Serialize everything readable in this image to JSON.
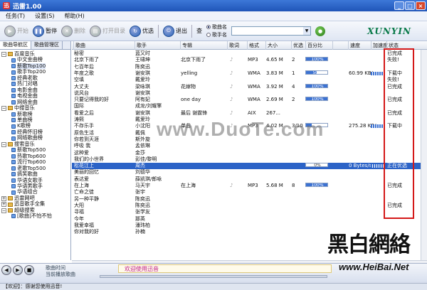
{
  "app": {
    "title": "迅雷1.00",
    "icon": "迅"
  },
  "menu": [
    "任务(T)",
    "设置(S)",
    "帮助(H)"
  ],
  "toolbar": {
    "buttons": [
      {
        "label": "开始",
        "enabled": false
      },
      {
        "label": "暂停",
        "enabled": true
      },
      {
        "label": "删除",
        "enabled": false
      },
      {
        "label": "打开目录",
        "enabled": false
      },
      {
        "label": "优选",
        "enabled": true
      },
      {
        "label": "退出",
        "enabled": true
      }
    ],
    "search_label": "查",
    "search_options": [
      {
        "label": "歌曲名",
        "selected": true
      },
      {
        "label": "歌手名",
        "selected": false
      }
    ],
    "search_value": "",
    "logo": "XUNYIN"
  },
  "sidebar": {
    "tabs": [
      "歌曲导航区",
      "歌曲管理区"
    ],
    "tree": [
      {
        "label": "百度音乐",
        "level": 0,
        "type": "folder",
        "expanded": true
      },
      {
        "label": "中文金曲榜",
        "level": 1
      },
      {
        "label": "新歌Top100",
        "level": 1
      },
      {
        "label": "歌手Top200",
        "level": 1
      },
      {
        "label": "经典老歌",
        "level": 1
      },
      {
        "label": "热门对唱",
        "level": 1
      },
      {
        "label": "电影金曲",
        "level": 1
      },
      {
        "label": "电视金曲",
        "level": 1
      },
      {
        "label": "网络金曲",
        "level": 1
      },
      {
        "label": "中搜音乐",
        "level": 0,
        "type": "folder",
        "expanded": true
      },
      {
        "label": "新歌榜",
        "level": 1
      },
      {
        "label": "单曲榜",
        "level": 1
      },
      {
        "label": "K歌榜",
        "level": 1
      },
      {
        "label": "经典怀旧榜",
        "level": 1
      },
      {
        "label": "网络歌曲榜",
        "level": 1
      },
      {
        "label": "搜索音乐",
        "level": 0,
        "type": "folder",
        "expanded": true
      },
      {
        "label": "新歌Top500",
        "level": 1
      },
      {
        "label": "热歌Top600",
        "level": 1
      },
      {
        "label": "流行Top600",
        "level": 1
      },
      {
        "label": "老歌Top500",
        "level": 1
      },
      {
        "label": "搞笑歌曲",
        "level": 1
      },
      {
        "label": "华语女歌手",
        "level": 1
      },
      {
        "label": "华语男歌手",
        "level": 1
      },
      {
        "label": "华语组合",
        "level": 1
      },
      {
        "label": "迅雷网吧",
        "level": 0,
        "type": "folder",
        "expanded": false
      },
      {
        "label": "迅音歌手全集",
        "level": 0,
        "type": "folder",
        "expanded": false
      },
      {
        "label": "超级搜索",
        "level": 0,
        "type": "folder",
        "expanded": true
      },
      {
        "label": "[歌曲]不怕不怕",
        "level": 1
      }
    ]
  },
  "table": {
    "columns": [
      "歌曲",
      "歌手",
      "专辑",
      "歌词",
      "格式",
      "大小",
      "优选",
      "百分比",
      "",
      "速度",
      "加速度",
      "状态"
    ],
    "rows": [
      {
        "song": "秘密",
        "artist": "蓝又时",
        "album": "",
        "fmt": "",
        "size": "",
        "pref": "",
        "pct": "",
        "speed": "",
        "status": "已完成"
      },
      {
        "song": "北京下雨了",
        "artist": "王啸坤",
        "album": "北京下雨了",
        "fmt": "MP3",
        "size": "4.65 M",
        "pref": "2",
        "pct": "100%",
        "pctv": 100,
        "speed": "",
        "status": "失败!"
      },
      {
        "song": "七百年后",
        "artist": "陈奕迅",
        "album": "",
        "fmt": "",
        "size": "",
        "pref": "",
        "pct": "",
        "speed": "",
        "status": ""
      },
      {
        "song": "年度之歌",
        "artist": "谢安琪",
        "album": "yelling",
        "fmt": "WMA",
        "size": "3.83 M",
        "pref": "1",
        "pct": "50%",
        "pctv": 50,
        "speed": "60.99 KB/s",
        "status": "下载中"
      },
      {
        "song": "空填",
        "artist": "戴爱玲",
        "album": "",
        "fmt": "",
        "size": "",
        "pref": "",
        "pct": "",
        "speed": "",
        "status": "失败!"
      },
      {
        "song": "大丈夫",
        "artist": "梁咏琪",
        "album": "花嫁物",
        "fmt": "WMA",
        "size": "3.92 M",
        "pref": "4",
        "pct": "100%",
        "pctv": 100,
        "speed": "",
        "status": "已完成"
      },
      {
        "song": "说风台",
        "artist": "谢安琪",
        "album": "",
        "fmt": "",
        "size": "",
        "pref": "",
        "pct": "",
        "speed": "",
        "status": ""
      },
      {
        "song": "只要记得我的好",
        "artist": "阿有妃",
        "album": "one day",
        "fmt": "WMA",
        "size": "2.69 M",
        "pref": "2",
        "pct": "100%",
        "pctv": 100,
        "speed": "",
        "status": "已完成"
      },
      {
        "song": "国际",
        "artist": "成龙/刘耀擎",
        "album": "",
        "fmt": "",
        "size": "",
        "pref": "",
        "pct": "",
        "speed": "",
        "status": ""
      },
      {
        "song": "看爱之后",
        "artist": "谢安琪",
        "album": "最后 谢霆锋",
        "fmt": "AIX",
        "size": "267...",
        "pref": "",
        "pct": "",
        "speed": "",
        "status": "已完成"
      },
      {
        "song": "涛熙",
        "artist": "戴爱玲",
        "album": "",
        "fmt": "",
        "size": "",
        "pref": "",
        "pct": "",
        "speed": "",
        "status": ""
      },
      {
        "song": "不存乐手",
        "artist": "小沈阳",
        "album": "单曲",
        "fmt": "MP3",
        "size": "4.02 M",
        "pref": "3/10",
        "pct": "26%",
        "pctv": 26,
        "speed": "275.28 KB/s",
        "status": "下载中"
      },
      {
        "song": "原色生活",
        "artist": "戴佩",
        "album": "",
        "fmt": "",
        "size": "",
        "pref": "",
        "pct": "",
        "speed": "",
        "status": ""
      },
      {
        "song": "你若到天涯",
        "artist": "斯外旋",
        "album": "",
        "fmt": "",
        "size": "",
        "pref": "",
        "pct": "",
        "speed": "",
        "status": ""
      },
      {
        "song": "呼吸 我",
        "artist": "孟依琳",
        "album": "",
        "fmt": "",
        "size": "",
        "pref": "",
        "pct": "",
        "speed": "",
        "status": ""
      },
      {
        "song": "这种爱",
        "artist": "金莎",
        "album": "",
        "fmt": "",
        "size": "",
        "pref": "",
        "pct": "",
        "speed": "",
        "status": ""
      },
      {
        "song": "我们的小世界",
        "artist": "彭佳/黎明",
        "album": "",
        "fmt": "",
        "size": "",
        "pref": "",
        "pct": "",
        "speed": "",
        "status": ""
      },
      {
        "song": "松花江上",
        "artist": "周杰",
        "album": "",
        "fmt": "",
        "size": "",
        "pref": "",
        "pct": "0%",
        "pctv": 0,
        "speed": "0 Bytes/s",
        "status": "正在优选",
        "hl": true
      },
      {
        "song": "美丽的回忆",
        "artist": "刘德华",
        "album": "",
        "fmt": "",
        "size": "",
        "pref": "",
        "pct": "",
        "speed": "",
        "status": ""
      },
      {
        "song": "表达爱",
        "artist": "薛凯琪/郎咏",
        "album": "",
        "fmt": "",
        "size": "",
        "pref": "",
        "pct": "",
        "speed": "",
        "status": ""
      },
      {
        "song": "在上海",
        "artist": "马天宇",
        "album": "在上海",
        "fmt": "MP3",
        "size": "5.68 M",
        "pref": "8",
        "pct": "100%",
        "pctv": 100,
        "speed": "",
        "status": "已完成"
      },
      {
        "song": "亡命之徒",
        "artist": "张宇",
        "album": "",
        "fmt": "",
        "size": "",
        "pref": "",
        "pct": "",
        "speed": "",
        "status": ""
      },
      {
        "song": "另一种平静",
        "artist": "陈奕迅",
        "album": "",
        "fmt": "",
        "size": "",
        "pref": "",
        "pct": "",
        "speed": "",
        "status": ""
      },
      {
        "song": "大阳",
        "artist": "陈奕迅",
        "album": "",
        "fmt": "",
        "size": "",
        "pref": "",
        "pct": "",
        "speed": "",
        "status": "已完成"
      },
      {
        "song": "寻福",
        "artist": "张学友",
        "album": "",
        "fmt": "",
        "size": "",
        "pref": "",
        "pct": "",
        "speed": "",
        "status": ""
      },
      {
        "song": "今年",
        "artist": "那英",
        "album": "",
        "fmt": "",
        "size": "",
        "pref": "",
        "pct": "",
        "speed": "",
        "status": ""
      },
      {
        "song": "我爱幸福",
        "artist": "潘玮柏",
        "album": "",
        "fmt": "",
        "size": "",
        "pref": "",
        "pct": "",
        "speed": "",
        "status": ""
      },
      {
        "song": "你对我的好",
        "artist": "孙楠",
        "album": "",
        "fmt": "",
        "size": "",
        "pref": "",
        "pct": "",
        "speed": "",
        "status": ""
      }
    ]
  },
  "watermark": "www.DuoTe.com",
  "player": {
    "time_label": "歌曲时间",
    "current_label": "当前播放歌曲",
    "marquee": "欢迎使用迅音"
  },
  "brand": {
    "chinese": "黑白網絡",
    "url": "www.HeiBai.Net"
  },
  "status": {
    "text": "【欢迎】：感谢您使用迅音!"
  },
  "colors": {
    "accent": "#2c63c7",
    "highlight_box": "#d41818",
    "progress": "#3c72d2"
  }
}
